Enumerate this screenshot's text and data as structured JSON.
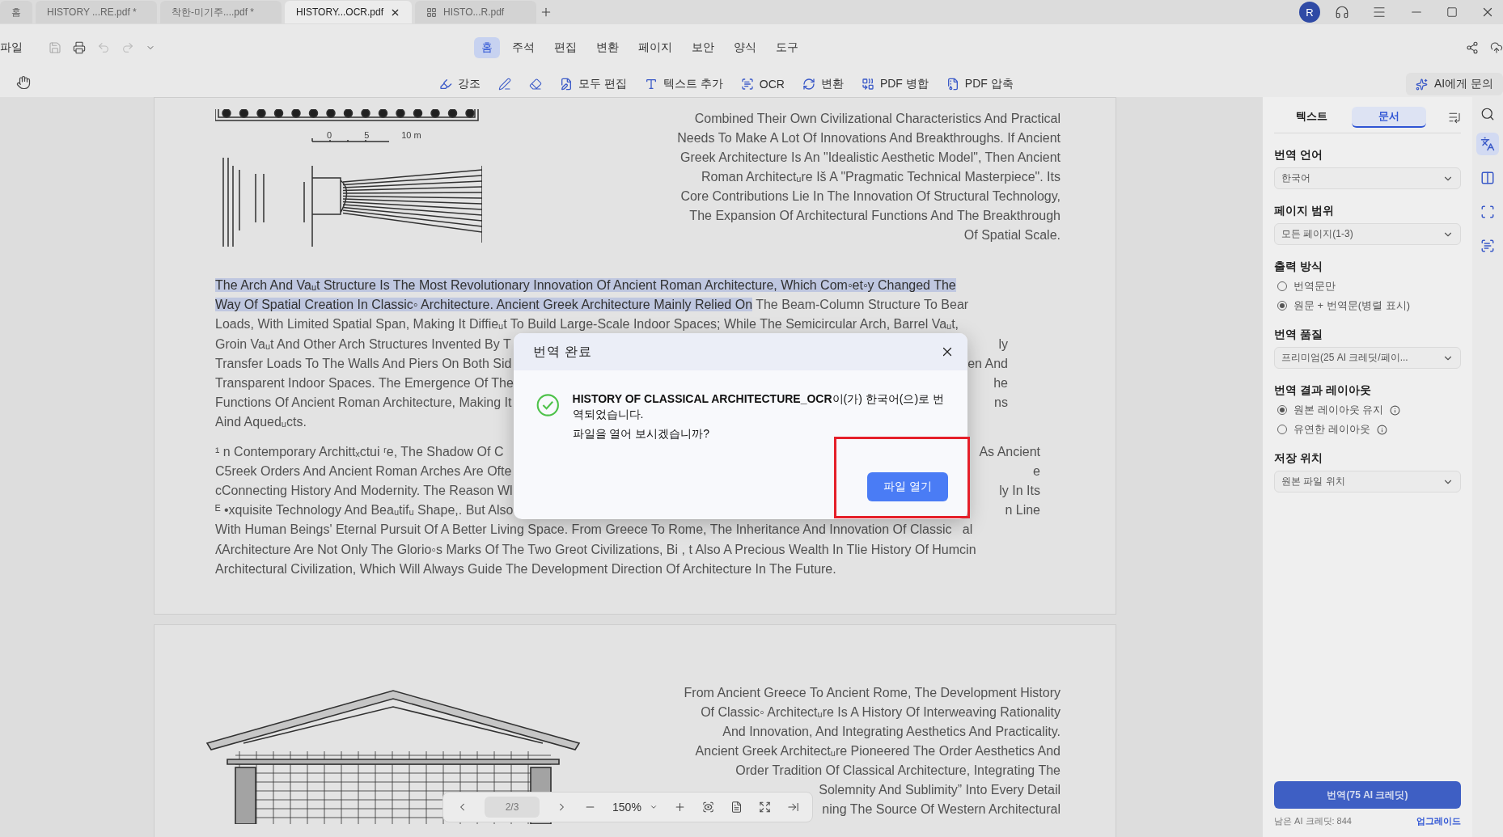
{
  "tabs": [
    {
      "label": "홈",
      "selected": false,
      "kind": "plain"
    },
    {
      "label": "HISTORY ...RE.pdf *",
      "selected": false,
      "kind": "plain"
    },
    {
      "label": "착한-미기주....pdf *",
      "selected": false,
      "kind": "plain"
    },
    {
      "label": "HISTORY...OCR.pdf",
      "selected": true,
      "kind": "plain"
    },
    {
      "label": "HISTO...R.pdf",
      "selected": false,
      "kind": "grid"
    }
  ],
  "avatar": "R",
  "file_menu": "파일",
  "menus": [
    {
      "label": "홈",
      "selected": true
    },
    {
      "label": "주석",
      "selected": false
    },
    {
      "label": "편집",
      "selected": false
    },
    {
      "label": "변환",
      "selected": false
    },
    {
      "label": "페이지",
      "selected": false
    },
    {
      "label": "보안",
      "selected": false
    },
    {
      "label": "양식",
      "selected": false
    },
    {
      "label": "도구",
      "selected": false
    }
  ],
  "tools": [
    "강조",
    "모두 편집",
    "텍스트 추가",
    "OCR",
    "변환",
    "PDF 병합",
    "PDF 압축"
  ],
  "ai_button": "AI에게 문의",
  "page1": {
    "scale_labels": [
      "0",
      "5",
      "10 m"
    ],
    "side_paragraph": [
      "Combined Their Own Civilizational Characteristics And Practical",
      "Needs To Make A Lot Of Innovations And Breakthroughs. If Ancient",
      "Greek Architecture Is An \"Idealistic Aesthetic Model\", Then Ancient",
      "Roman Architectᵤre Iš A \"Pragmatic Technical Masterpiece\". Its",
      "Core Contributions Lie In The Innovation Of Structural Technology,",
      "The Expansion Of Architectural Functions And The Breakthrough",
      "Of Spatial Scale."
    ],
    "body_lines": [
      {
        "segments": [
          {
            "text": "The Arch And Vaᵤt Structure Is The Most Revolutionary Innovation Of Ancient Roman Architecture, Which Com◦et◦y Changed The",
            "highlighted": true
          }
        ]
      },
      {
        "segments": [
          {
            "text": "Way Of Spatial Creation In Classic◦ Architecture. Ancient Greek Architecture Mainly Relied On",
            "highlighted": true
          },
          {
            "text": " The Beam-Column Structure To Bear",
            "highlighted": false
          }
        ]
      },
      {
        "segments": [
          {
            "text": "Loads, With Limited Spatial Span, Making It Diffieᵤt To Build Large-Scale Indoor Spaces; While The Semicircular Arch, Barrel Vaᵤt,",
            "highlighted": false
          }
        ]
      },
      {
        "segments": [
          {
            "text": "Groin Vaᵤt And Other Arch Structures Invented By T",
            "highlighted": false
          }
        ],
        "right": "ly"
      },
      {
        "segments": [
          {
            "text": "Transfer Loads To The Walls And Piers On Both Sid",
            "highlighted": false
          }
        ],
        "right": "en And"
      },
      {
        "segments": [
          {
            "text": "Transparent Indoor Spaces. The Emergence Of The",
            "highlighted": false
          }
        ],
        "right": "he"
      },
      {
        "segments": [
          {
            "text": "Functions Of Ancient Roman Architecture, Making It",
            "highlighted": false
          }
        ],
        "right": "ns"
      },
      {
        "segments": [
          {
            "text": "Aind Aquedᵤcts.",
            "highlighted": false
          }
        ]
      }
    ],
    "footnote_lines": [
      {
        "segments": [
          {
            "text": "¹ n Contemporary Archittₓctui ʳe, The Shadow Of C",
            "highlighted": false
          }
        ],
        "right": "As Ancient"
      },
      {
        "segments": [
          {
            "text": "C5reek Orders And Ancient Roman Arches Are Ofte",
            "highlighted": false
          }
        ],
        "right": "e"
      },
      {
        "segments": [
          {
            "text": "cConnecting History And Modernity. The Reason Wl",
            "highlighted": false
          }
        ],
        "right": "ly In Its"
      },
      {
        "segments": [
          {
            "text": "ᴱ •xquisite Technology And Beaᵤtifᵤ Shape,. But Also",
            "highlighted": false
          }
        ],
        "right": "n Line"
      },
      {
        "segments": [
          {
            "text": "With Human Beings' Eternal Pursuit Of A Better Living Space. From Greece To Rome, The Inheritance And Innovation Of Classic   al",
            "highlighted": false
          }
        ]
      },
      {
        "segments": [
          {
            "text": "ʎArchitecture Are Not Only The Glorio◦s Marks Of The Two Greot Civilizations, Bi , t Also A Precious Wealth In Tlie History Of Humcin",
            "highlighted": false
          }
        ]
      },
      {
        "segments": [
          {
            "text": "Architectural Civilization, Which Will Always Guide The Development Direction Of Architecture In The Future.",
            "highlighted": false
          }
        ]
      }
    ]
  },
  "page2": {
    "side_lines": [
      "From Ancient Greece To Ancient Rome, The Development History",
      "Of Classic◦ Architectᵤre Is A History Of Interweaving Rationality",
      "And Innovation, And Integrating Aesthetics And Practicality.",
      "Ancient Greek Architectᵤre Pioneered The Order Aesthetics And",
      "Order Tradition Of Classical Architecture, Integrating The",
      "Solemnity And Sublimity” Into Every Detail",
      "ning The Source Of Western Architectural"
    ]
  },
  "dialog": {
    "title": "번역 완료",
    "message": "**HISTORY OF CLASSICAL ARCHITECTURE_OCR**이(가) 한국어(으)로 번역되었습니다.",
    "question": "파일을 열어 보시겠습니까?",
    "button": "파일 열기"
  },
  "navigator": {
    "page": "2/3",
    "zoom": "150%"
  },
  "panel": {
    "tabs": [
      {
        "label": "텍스트",
        "selected": false
      },
      {
        "label": "문서",
        "selected": true
      }
    ],
    "sections": [
      {
        "kind": "select",
        "title": "번역 언어",
        "value": "한국어"
      },
      {
        "kind": "select",
        "title": "페이지 범위",
        "value": "모든 페이지(1-3)"
      },
      {
        "kind": "radio",
        "title": "출력 방식",
        "options": [
          {
            "label": "번역문만",
            "selected": false,
            "info": false
          },
          {
            "label": "원문 + 번역문(병렬 표시)",
            "selected": true,
            "info": false
          }
        ]
      },
      {
        "kind": "select",
        "title": "번역 품질",
        "value": "프리미엄(25 AI 크레딧/페이..."
      },
      {
        "kind": "radio",
        "title": "번역 결과 레이아웃",
        "options": [
          {
            "label": "원본 레이아웃 유지",
            "selected": true,
            "info": true
          },
          {
            "label": "유연한 레이아웃",
            "selected": false,
            "info": true
          }
        ]
      },
      {
        "kind": "select",
        "title": "저장 위치",
        "value": "원본 파일 위치"
      }
    ],
    "translate_button": "번역(75 AI 크레딧)",
    "credits": "남은 AI 크레딧: 844",
    "upgrade": "업그레이드"
  }
}
